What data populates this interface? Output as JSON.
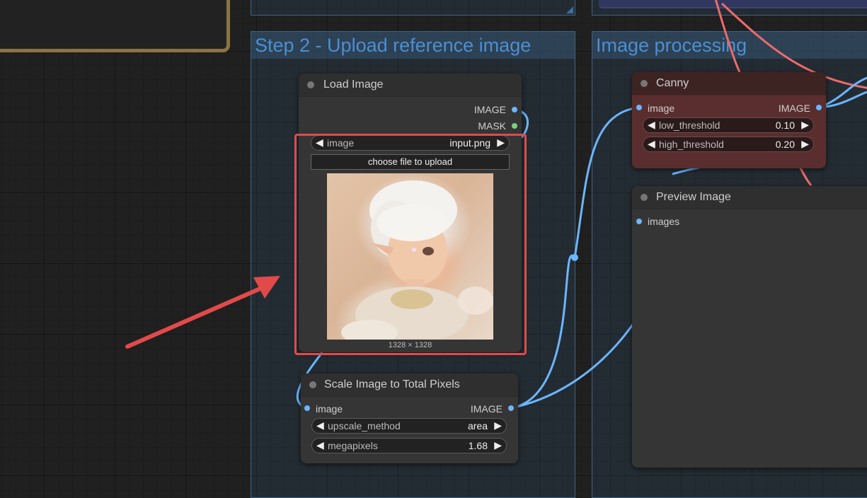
{
  "groups": [
    {
      "title": "Step 2 - Upload reference image"
    },
    {
      "title": "Image processing"
    }
  ],
  "load_image": {
    "title": "Load Image",
    "outputs": [
      "IMAGE",
      "MASK"
    ],
    "image_widget": {
      "label": "image",
      "value": "input.png"
    },
    "upload_label": "choose file to upload",
    "image_size": "1328 × 1328"
  },
  "scale_image": {
    "title": "Scale Image to Total Pixels",
    "input": "image",
    "output": "IMAGE",
    "widgets": [
      {
        "label": "upscale_method",
        "value": "area"
      },
      {
        "label": "megapixels",
        "value": "1.68"
      }
    ]
  },
  "canny": {
    "title": "Canny",
    "input": "image",
    "output": "IMAGE",
    "widgets": [
      {
        "label": "low_threshold",
        "value": "0.10"
      },
      {
        "label": "high_threshold",
        "value": "0.20"
      }
    ]
  },
  "preview_image": {
    "title": "Preview Image",
    "input": "images"
  },
  "colors": {
    "link_blue": "#6bb6ff",
    "link_red": "#f06a6a",
    "annotation_red": "#e24a4a",
    "group_title": "#4b8fd1",
    "canny_body": "#5a2e2e"
  },
  "icons": {
    "arrow_left": "◀",
    "arrow_right": "▶",
    "left_small": "◀",
    "right_small": "▶"
  }
}
